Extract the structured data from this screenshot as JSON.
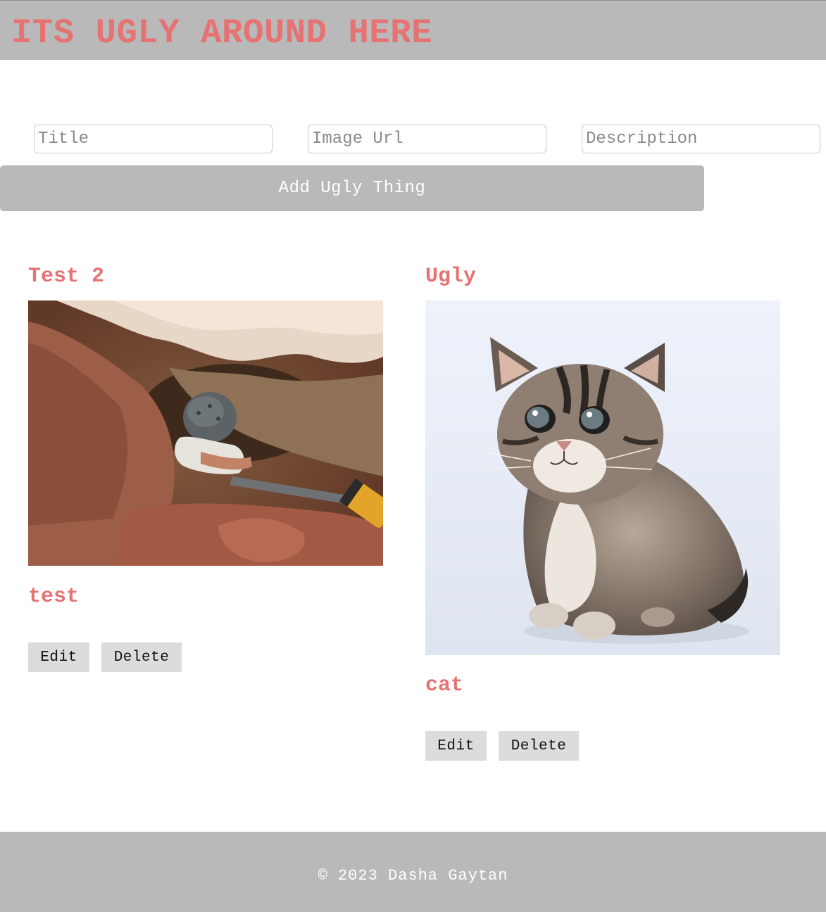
{
  "header": {
    "title": "ITS UGLY AROUND HERE"
  },
  "form": {
    "title_placeholder": "Title",
    "image_url_placeholder": "Image Url",
    "description_placeholder": "Description",
    "submit_label": "Add Ugly Thing"
  },
  "things": [
    {
      "title": "Test 2",
      "image_subject": "person in helmet crawling through a narrow cave",
      "description": "test",
      "edit_label": "Edit",
      "delete_label": "Delete"
    },
    {
      "title": "Ugly",
      "image_subject": "tabby kitten sitting on a white background",
      "description": "cat",
      "edit_label": "Edit",
      "delete_label": "Delete"
    }
  ],
  "footer": {
    "text": "© 2023 Dasha Gaytan"
  },
  "colors": {
    "accent": "#e57373",
    "bar": "#b9b9b9",
    "button": "#dcdcdc"
  }
}
